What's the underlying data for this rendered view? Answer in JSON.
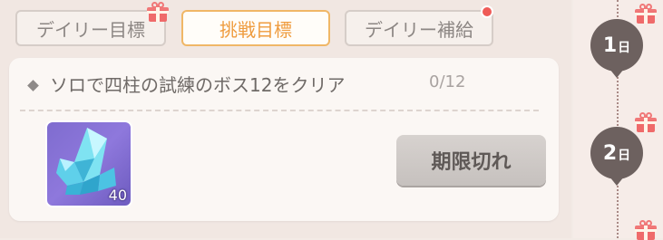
{
  "tabs": [
    {
      "label": "デイリー目標",
      "active": false
    },
    {
      "label": "挑戦目標",
      "active": true
    },
    {
      "label": "デイリー補給",
      "active": false
    }
  ],
  "mission": {
    "title": "ソロで四柱の試練のボス12をクリア",
    "progress": "0/12",
    "reward": {
      "icon": "crystal-icon",
      "quantity": "40"
    },
    "status_button": "期限切れ"
  },
  "sidebar": {
    "days": [
      {
        "num": "1",
        "unit": "日"
      },
      {
        "num": "2",
        "unit": "日"
      }
    ]
  },
  "colors": {
    "accent": "#ef9c3f",
    "notification": "#ef5b57",
    "gift": "#ef6a6a"
  }
}
